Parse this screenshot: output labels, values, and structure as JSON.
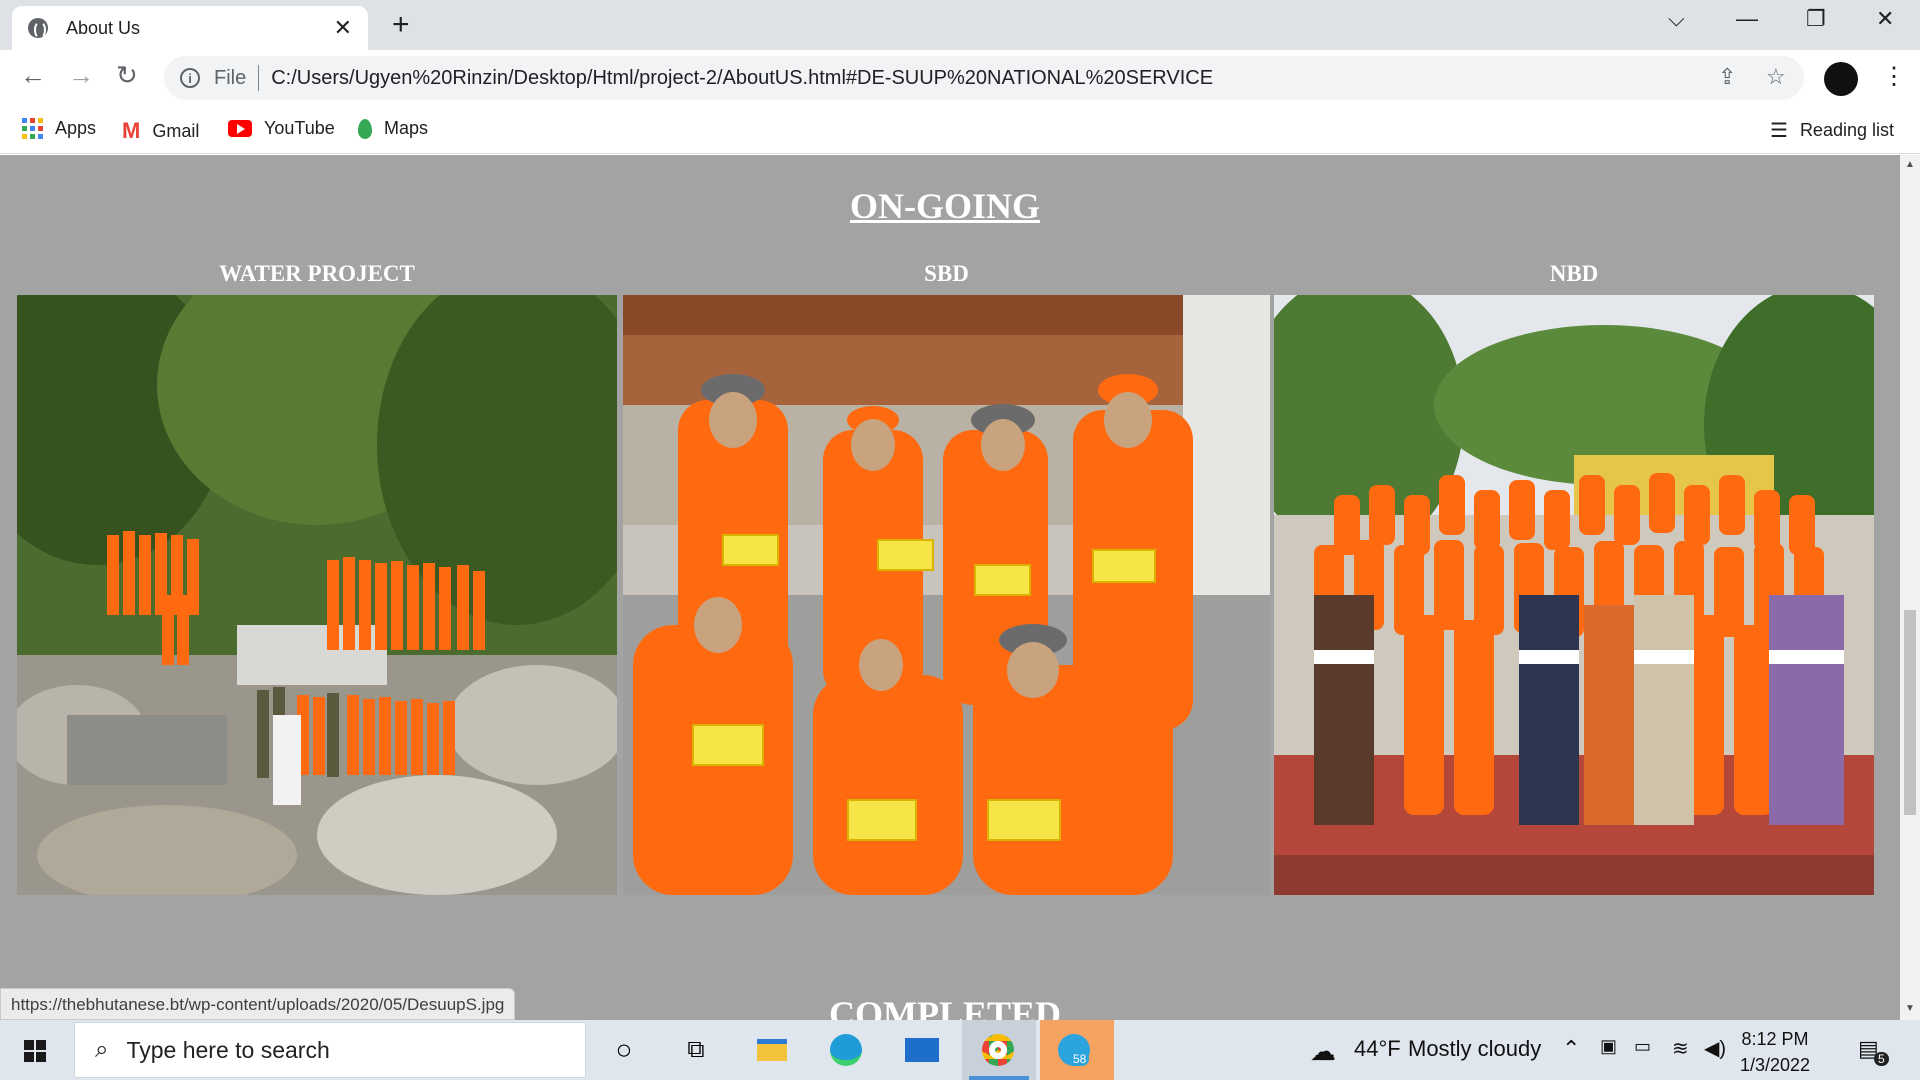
{
  "browser": {
    "tab_title": "About Us",
    "tab_close": "✕",
    "new_tab": "+",
    "window_controls": [
      "⌵",
      "—",
      "❐",
      "✕"
    ],
    "nav": {
      "back": "←",
      "forward": "→",
      "reload": "↻"
    },
    "omnibox": {
      "scheme_label": "File",
      "url": "C:/Users/Ugyen%20Rinzin/Desktop/Html/project-2/AboutUS.html#DE-SUUP%20NATIONAL%20SERVICE"
    },
    "bookmarks": [
      {
        "label": "Apps",
        "icon": "apps-grid-icon"
      },
      {
        "label": "Gmail",
        "icon": "gmail-icon"
      },
      {
        "label": "YouTube",
        "icon": "youtube-icon"
      },
      {
        "label": "Maps",
        "icon": "maps-icon"
      }
    ],
    "reading_list": "Reading list",
    "status_url": "https://thebhutanese.bt/wp-content/uploads/2020/05/DesuupS.jpg"
  },
  "page": {
    "section_ongoing": "ON-GOING",
    "section_completed": "COMPLETED",
    "projects": [
      {
        "caption": "WATER PROJECT",
        "photo": "water-project-photo"
      },
      {
        "caption": "SBD",
        "photo": "sbd-photo"
      },
      {
        "caption": "NBD",
        "photo": "nbd-photo"
      }
    ],
    "colors": {
      "background": "#a3a3a3",
      "uniform": "#ff6a10",
      "text": "#ffffff"
    }
  },
  "taskbar": {
    "search_placeholder": "Type here to search",
    "telegram_badge": "58",
    "weather": {
      "temp": "44°F",
      "condition": "Mostly cloudy"
    },
    "time": "8:12 PM",
    "date": "1/3/2022",
    "notification_count": "5"
  }
}
